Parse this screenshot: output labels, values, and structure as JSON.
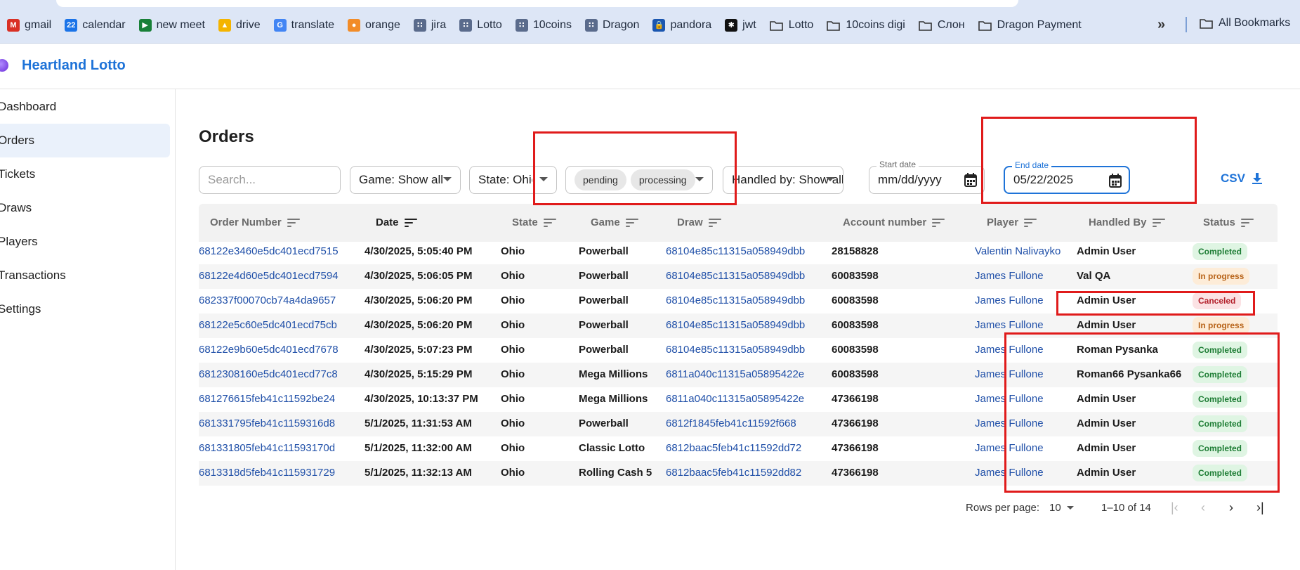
{
  "bookmarks": {
    "items": [
      {
        "label": "gmail",
        "icon": "gmail-icon",
        "color": "#d93025",
        "glyph": "M"
      },
      {
        "label": "calendar",
        "icon": "calendar-icon",
        "color": "#1a73e8",
        "glyph": "22"
      },
      {
        "label": "new meet",
        "icon": "meet-icon",
        "color": "#188038",
        "glyph": "▶"
      },
      {
        "label": "drive",
        "icon": "drive-icon",
        "color": "#f4b400",
        "glyph": "▲"
      },
      {
        "label": "translate",
        "icon": "translate-icon",
        "color": "#4285f4",
        "glyph": "G"
      },
      {
        "label": "orange",
        "icon": "orange-icon",
        "color": "#f28c28",
        "glyph": "●"
      },
      {
        "label": "jira",
        "icon": "jira-icon",
        "color": "#5a6b8c",
        "glyph": "∷"
      },
      {
        "label": "Lotto",
        "icon": "lotto-icon",
        "color": "#5a6b8c",
        "glyph": "∷"
      },
      {
        "label": "10coins",
        "icon": "coins-icon",
        "color": "#5a6b8c",
        "glyph": "∷"
      },
      {
        "label": "Dragon",
        "icon": "dragon-icon",
        "color": "#5a6b8c",
        "glyph": "∷"
      },
      {
        "label": "pandora",
        "icon": "lock-icon",
        "color": "#1a56b0",
        "glyph": "🔒"
      },
      {
        "label": "jwt",
        "icon": "jwt-icon",
        "color": "#111111",
        "glyph": "✱"
      }
    ],
    "folders": [
      "Lotto",
      "10coins digi",
      "Слон",
      "Dragon Payment"
    ],
    "overflow": "»",
    "all_bookmarks": "All Bookmarks"
  },
  "app": {
    "title": "Heartland Lotto",
    "accent": "#1e73d8"
  },
  "sidebar": {
    "items": [
      {
        "label": "Dashboard",
        "active": false
      },
      {
        "label": "Orders",
        "active": true
      },
      {
        "label": "Tickets",
        "active": false
      },
      {
        "label": "Draws",
        "active": false
      },
      {
        "label": "Players",
        "active": false
      },
      {
        "label": "Transactions",
        "active": false
      },
      {
        "label": "Settings",
        "active": false
      }
    ]
  },
  "page": {
    "title": "Orders"
  },
  "filters": {
    "search_placeholder": "Search...",
    "game": "Game: Show all",
    "state": "State: Ohio",
    "status_chips": [
      "pending",
      "processing"
    ],
    "handled_by": "Handled by: Show all",
    "start_date_label": "Start date",
    "start_date_value": "mm/dd/yyyy",
    "end_date_label": "End date",
    "end_date_value": "05/22/2025",
    "csv_label": "CSV"
  },
  "table": {
    "columns": [
      "Order Number",
      "Date",
      "State",
      "Game",
      "Draw",
      "Account number",
      "Player",
      "Handled By",
      "Status"
    ],
    "rows": [
      {
        "order": "68122e3460e5dc401ecd7515",
        "date": "4/30/2025, 5:05:40 PM",
        "state": "Ohio",
        "game": "Powerball",
        "draw": "68104e85c11315a058949dbb",
        "account": "28158828",
        "player": "Valentin Nalivayko",
        "handled_by": "Admin User",
        "status": "Completed"
      },
      {
        "order": "68122e4d60e5dc401ecd7594",
        "date": "4/30/2025, 5:06:05 PM",
        "state": "Ohio",
        "game": "Powerball",
        "draw": "68104e85c11315a058949dbb",
        "account": "60083598",
        "player": "James Fullone",
        "handled_by": "Val QA",
        "status": "In progress"
      },
      {
        "order": "682337f00070cb74a4da9657",
        "date": "4/30/2025, 5:06:20 PM",
        "state": "Ohio",
        "game": "Powerball",
        "draw": "68104e85c11315a058949dbb",
        "account": "60083598",
        "player": "James Fullone",
        "handled_by": "Admin User",
        "status": "Canceled"
      },
      {
        "order": "68122e5c60e5dc401ecd75cb",
        "date": "4/30/2025, 5:06:20 PM",
        "state": "Ohio",
        "game": "Powerball",
        "draw": "68104e85c11315a058949dbb",
        "account": "60083598",
        "player": "James Fullone",
        "handled_by": "Admin User",
        "status": "In progress"
      },
      {
        "order": "68122e9b60e5dc401ecd7678",
        "date": "4/30/2025, 5:07:23 PM",
        "state": "Ohio",
        "game": "Powerball",
        "draw": "68104e85c11315a058949dbb",
        "account": "60083598",
        "player": "James Fullone",
        "handled_by": "Roman Pysanka",
        "status": "Completed"
      },
      {
        "order": "6812308160e5dc401ecd77c8",
        "date": "4/30/2025, 5:15:29 PM",
        "state": "Ohio",
        "game": "Mega Millions",
        "draw": "6811a040c11315a05895422e",
        "account": "60083598",
        "player": "James Fullone",
        "handled_by": "Roman66 Pysanka66",
        "status": "Completed"
      },
      {
        "order": "681276615feb41c11592be24",
        "date": "4/30/2025, 10:13:37 PM",
        "state": "Ohio",
        "game": "Mega Millions",
        "draw": "6811a040c11315a05895422e",
        "account": "47366198",
        "player": "James Fullone",
        "handled_by": "Admin User",
        "status": "Completed"
      },
      {
        "order": "681331795feb41c1159316d8",
        "date": "5/1/2025, 11:31:53 AM",
        "state": "Ohio",
        "game": "Powerball",
        "draw": "6812f1845feb41c11592f668",
        "account": "47366198",
        "player": "James Fullone",
        "handled_by": "Admin User",
        "status": "Completed"
      },
      {
        "order": "681331805feb41c11593170d",
        "date": "5/1/2025, 11:32:00 AM",
        "state": "Ohio",
        "game": "Classic Lotto",
        "draw": "6812baac5feb41c11592dd72",
        "account": "47366198",
        "player": "James Fullone",
        "handled_by": "Admin User",
        "status": "Completed"
      },
      {
        "order": "6813318d5feb41c115931729",
        "date": "5/1/2025, 11:32:13 AM",
        "state": "Ohio",
        "game": "Rolling Cash 5",
        "draw": "6812baac5feb41c11592dd82",
        "account": "47366198",
        "player": "James Fullone",
        "handled_by": "Admin User",
        "status": "Completed"
      }
    ]
  },
  "pagination": {
    "rows_per_page_label": "Rows per page:",
    "rows_per_page": "10",
    "range": "1–10 of 14"
  },
  "colors": {
    "annotation": "#e01b1b",
    "completed_bg": "#dff5e3",
    "inprogress_bg": "#fdecd8",
    "canceled_bg": "#fbe2e4"
  }
}
